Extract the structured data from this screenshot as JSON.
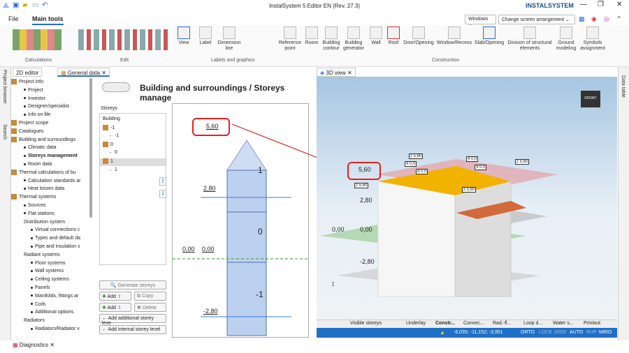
{
  "app": {
    "title": "InstalSystem 5 Editor EN (Rev. 27.3)",
    "logo_text": "INSTALSYSTEM",
    "windows_btn": "Windows",
    "arrangement_btn": "Change screen arrangement"
  },
  "menu": {
    "file": "File",
    "main_tools": "Main tools"
  },
  "ribbon": {
    "groups": {
      "calculations": "Calculations",
      "edit": "Edit",
      "labels": "Labels and graphics",
      "construction": "Construction"
    },
    "view": "View",
    "label": "Label",
    "dimension": "Dimension line",
    "reference": "Reference point",
    "room": "Room",
    "building_contour": "Building contour",
    "building_generator": "Building generator",
    "wall": "Wall",
    "roof": "Roof",
    "door": "Door/Opening",
    "window": "Window/Recess",
    "slab": "Slab/Opening",
    "division": "Division of structural elements",
    "ground": "Ground modeling",
    "symbols": "Symbols assignment"
  },
  "tabs": {
    "editor2d": "2D editor",
    "general": "General data",
    "view3d": "3D view"
  },
  "side": {
    "project_browser": "Project browser",
    "search": "Search",
    "data_table": "Data table",
    "diagnostics": "Diagnostics"
  },
  "tree": [
    {
      "label": "Project info",
      "lvl": 0,
      "ic": "folder"
    },
    {
      "label": "Project",
      "lvl": 1
    },
    {
      "label": "Investor",
      "lvl": 1
    },
    {
      "label": "Designer/specialist",
      "lvl": 1
    },
    {
      "label": "Info on file",
      "lvl": 1
    },
    {
      "label": "Project scope",
      "lvl": 0,
      "ic": "folder"
    },
    {
      "label": "Catalogues",
      "lvl": 0,
      "ic": "folder"
    },
    {
      "label": "Building and surroundings",
      "lvl": 0,
      "ic": "folder"
    },
    {
      "label": "Climatic data",
      "lvl": 1
    },
    {
      "label": "Storeys management",
      "lvl": 1,
      "bold": true
    },
    {
      "label": "Room data",
      "lvl": 1
    },
    {
      "label": "Thermal calculations of bu",
      "lvl": 0,
      "ic": "folder"
    },
    {
      "label": "Calculation standards ar",
      "lvl": 1
    },
    {
      "label": "Heat losses data",
      "lvl": 1
    },
    {
      "label": "Thermal systems",
      "lvl": 0,
      "ic": "folder"
    },
    {
      "label": "Sources",
      "lvl": 1
    },
    {
      "label": "Flat stations",
      "lvl": 1
    },
    {
      "label": "Distribution system",
      "lvl": 1,
      "nodot": true
    },
    {
      "label": "Virtual connections c",
      "lvl": 2
    },
    {
      "label": "Types and default da",
      "lvl": 2
    },
    {
      "label": "Pipe and insulation s",
      "lvl": 2
    },
    {
      "label": "Radiant systems",
      "lvl": 1,
      "nodot": true
    },
    {
      "label": "Floor systems",
      "lvl": 2
    },
    {
      "label": "Wall systems",
      "lvl": 2
    },
    {
      "label": "Ceiling systems",
      "lvl": 2
    },
    {
      "label": "Panels",
      "lvl": 2
    },
    {
      "label": "Manifolds, fittings ar",
      "lvl": 2
    },
    {
      "label": "Coils",
      "lvl": 2
    },
    {
      "label": "Additional options",
      "lvl": 2
    },
    {
      "label": "Radiators",
      "lvl": 1,
      "nodot": true
    },
    {
      "label": "Radiators/Radiator v",
      "lvl": 2
    }
  ],
  "panel": {
    "title": "Building and surroundings / Storeys manage",
    "storeys_label": "Storeys",
    "list": [
      "Building",
      "-1",
      "-1",
      "0",
      "0",
      "1",
      "1"
    ],
    "buttons": {
      "generate": "Generate storeys",
      "add": "Add",
      "copy": "Copy",
      "delete": "Delete",
      "add_additional": "Add additional storey leve",
      "add_internal": "Add internal storey level"
    }
  },
  "section": {
    "levels": [
      "5,60",
      "2,80",
      "0,00",
      "0,00",
      "-2,80"
    ],
    "storeys": [
      "1",
      "0",
      "-1"
    ]
  },
  "view3d": {
    "levels": [
      "5,60",
      "2,80",
      "0,00",
      "0,00",
      "-2,80"
    ],
    "z_tags": [
      "z 5,60",
      "z 5,60",
      "z 5,60",
      "z 5,60"
    ],
    "h_tags": [
      "4 0,0",
      "4 0,0",
      "4 0,0",
      "4 0,0"
    ],
    "cube": "FRONT",
    "bottom_tabs": [
      "Visible storeys",
      "Underlay",
      "Constr...",
      "Convec...",
      "Rad.-fl...",
      "Loop d...",
      "Water s...",
      "Printout"
    ],
    "coords": "-6,035; -11,152; -3,951",
    "status": [
      "ORTO",
      "LOCK",
      "GRID",
      "AUTO",
      "RUP",
      "MIRO"
    ]
  }
}
